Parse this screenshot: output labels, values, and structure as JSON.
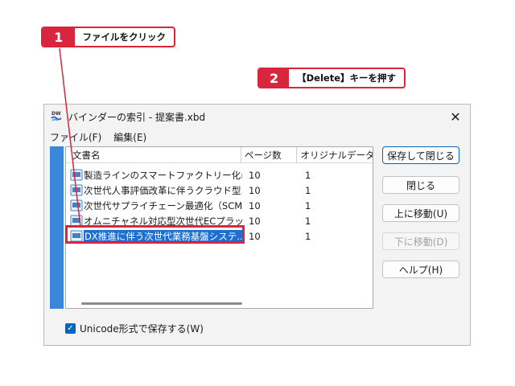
{
  "callouts": [
    {
      "number": "1",
      "text": "ファイルをクリック"
    },
    {
      "number": "2",
      "text": "【Delete】キーを押す"
    }
  ],
  "window": {
    "title": "バインダーの索引 - 提案書.xbd",
    "close_glyph": "✕",
    "app_icon_text": "DW"
  },
  "menu": [
    {
      "label": "ファイル(F)"
    },
    {
      "label": "編集(E)"
    }
  ],
  "list": {
    "columns": [
      "文書名",
      "ページ数",
      "オリジナルデータ数"
    ],
    "rows": [
      {
        "name": "製造ラインのスマートファクトリー化に伴う...",
        "pages": "10",
        "orig": "1",
        "selected": false
      },
      {
        "name": "次世代人事評価改革に伴うクラウド型...",
        "pages": "10",
        "orig": "1",
        "selected": false
      },
      {
        "name": "次世代サプライチェーン最適化（SCM...",
        "pages": "10",
        "orig": "1",
        "selected": false
      },
      {
        "name": "オムニチャネル対応型次世代ECプラット...",
        "pages": "10",
        "orig": "1",
        "selected": false
      },
      {
        "name": "DX推進に伴う次世代業務基盤システ...",
        "pages": "10",
        "orig": "1",
        "selected": true
      }
    ]
  },
  "buttons": {
    "save_close": "保存して閉じる",
    "close": "閉じる",
    "move_up": "上に移動(U)",
    "move_down": "下に移動(D)",
    "help": "ヘルプ(H)"
  },
  "checkbox": {
    "label": "Unicode形式で保存する(W)",
    "checked": true
  },
  "colors": {
    "accent_red": "#d7263d",
    "selection_blue": "#1f6fd1",
    "sidebar_blue": "#3a86d9"
  }
}
